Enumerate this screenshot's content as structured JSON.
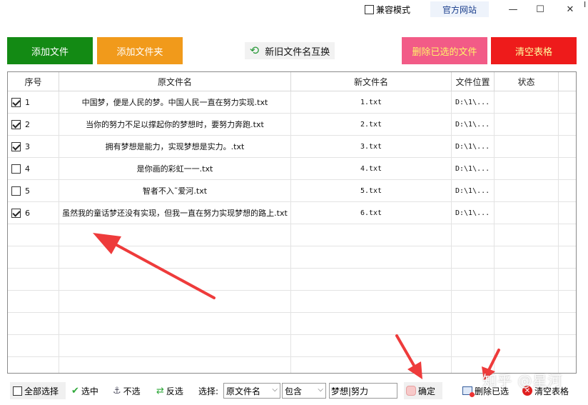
{
  "titlebar": {
    "compat_label": "兼容模式",
    "official_label": "官方网站",
    "minimize_glyph": "—",
    "maximize_glyph": "☐",
    "close_glyph": "✕",
    "edge_glyph": "I"
  },
  "toolbar": {
    "add_file": "添加文件",
    "add_folder": "添加文件夹",
    "swap_names": "新旧文件名互换",
    "delete_selected": "删除已选的文件",
    "clear_table": "清空表格"
  },
  "table": {
    "columns": [
      "序号",
      "原文件名",
      "新文件名",
      "文件位置",
      "状态"
    ],
    "rows": [
      {
        "seq": "1",
        "checked": true,
        "original": "中国梦，便是人民的梦。中国人民一直在努力实现.txt",
        "new": "1.txt",
        "location": "D:\\1\\...",
        "status": ""
      },
      {
        "seq": "2",
        "checked": true,
        "original": "当你的努力不足以撑起你的梦想时，要努力奔跑.txt",
        "new": "2.txt",
        "location": "D:\\1\\...",
        "status": ""
      },
      {
        "seq": "3",
        "checked": true,
        "original": "拥有梦想是能力，实现梦想是实力。.txt",
        "new": "3.txt",
        "location": "D:\\1\\...",
        "status": ""
      },
      {
        "seq": "4",
        "checked": false,
        "original": "是你画的彩虹一一.txt",
        "new": "4.txt",
        "location": "D:\\1\\...",
        "status": ""
      },
      {
        "seq": "5",
        "checked": false,
        "original": "智者不入˜爱河.txt",
        "new": "5.txt",
        "location": "D:\\1\\...",
        "status": ""
      },
      {
        "seq": "6",
        "checked": true,
        "original": "虽然我的童话梦还没有实现，但我一直在努力实现梦想的路上.txt",
        "new": "6.txt",
        "location": "D:\\1\\...",
        "status": ""
      }
    ]
  },
  "bottombar": {
    "select_all": "全部选择",
    "select": "选中",
    "unselect": "不选",
    "invert": "反选",
    "select_label": "选择:",
    "field_value": "原文件名",
    "match_value": "包含",
    "keyword_value": "梦想|努力",
    "confirm": "确定",
    "delete_selected": "删除已选",
    "clear_table": "清空表格"
  },
  "watermark": "知乎 @星河",
  "colors": {
    "add_file_bg": "#138a14",
    "add_folder_bg": "#f19a1b",
    "delete_selected_bg": "#f25b87",
    "clear_table_bg": "#ee1b1b",
    "annotation_arrow": "#ee3b3b"
  }
}
